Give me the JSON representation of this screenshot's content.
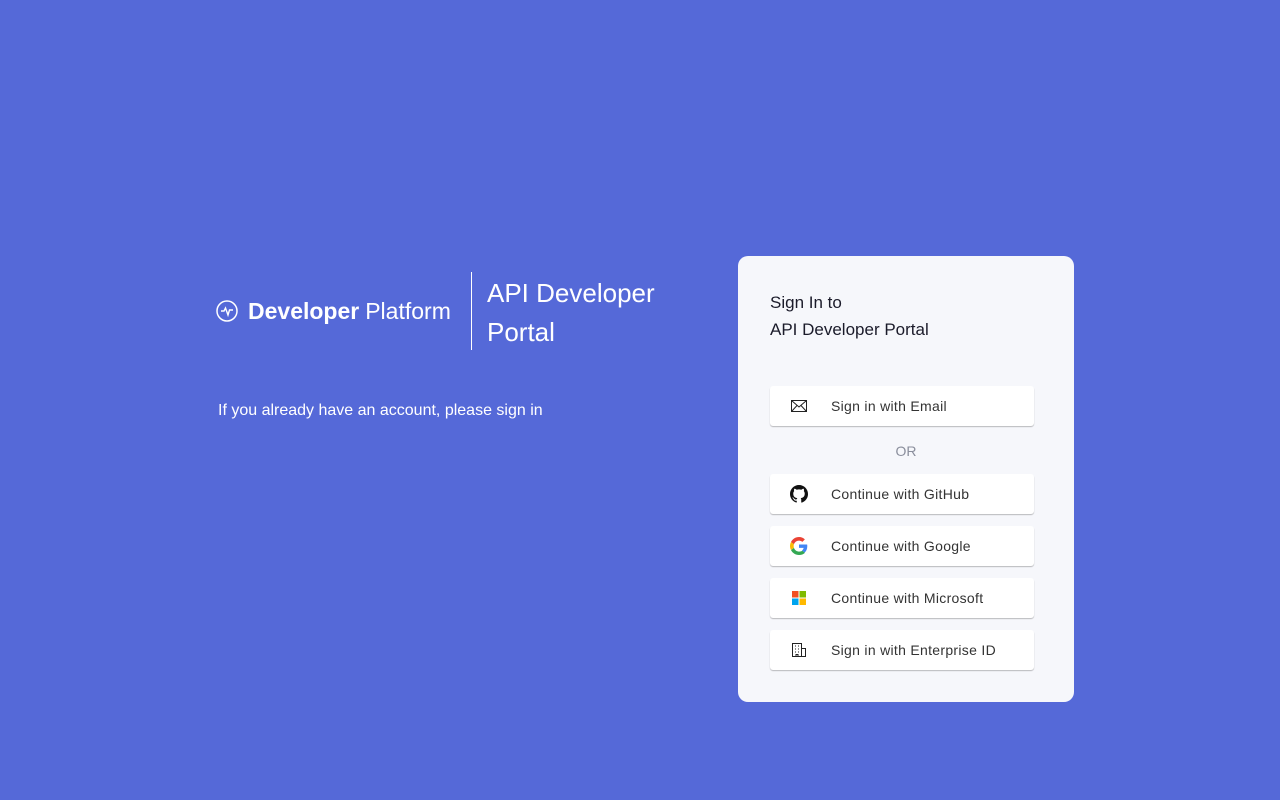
{
  "brand": {
    "bold": "Developer",
    "light": "Platform",
    "icon": "pulse-circle-icon"
  },
  "portal_title": "API Developer Portal",
  "tagline": "If you already have an account, please sign in",
  "card": {
    "title_line1": "Sign In to",
    "title_line2": "API Developer Portal",
    "or_label": "OR",
    "buttons": [
      {
        "label": "Sign in with Email",
        "icon": "envelope-icon"
      },
      {
        "label": "Continue with GitHub",
        "icon": "github-icon"
      },
      {
        "label": "Continue with Google",
        "icon": "google-icon"
      },
      {
        "label": "Continue with Microsoft",
        "icon": "microsoft-icon"
      },
      {
        "label": "Sign in with Enterprise ID",
        "icon": "building-icon"
      }
    ]
  },
  "colors": {
    "background": "#5569d8",
    "card": "#f6f7fb"
  }
}
